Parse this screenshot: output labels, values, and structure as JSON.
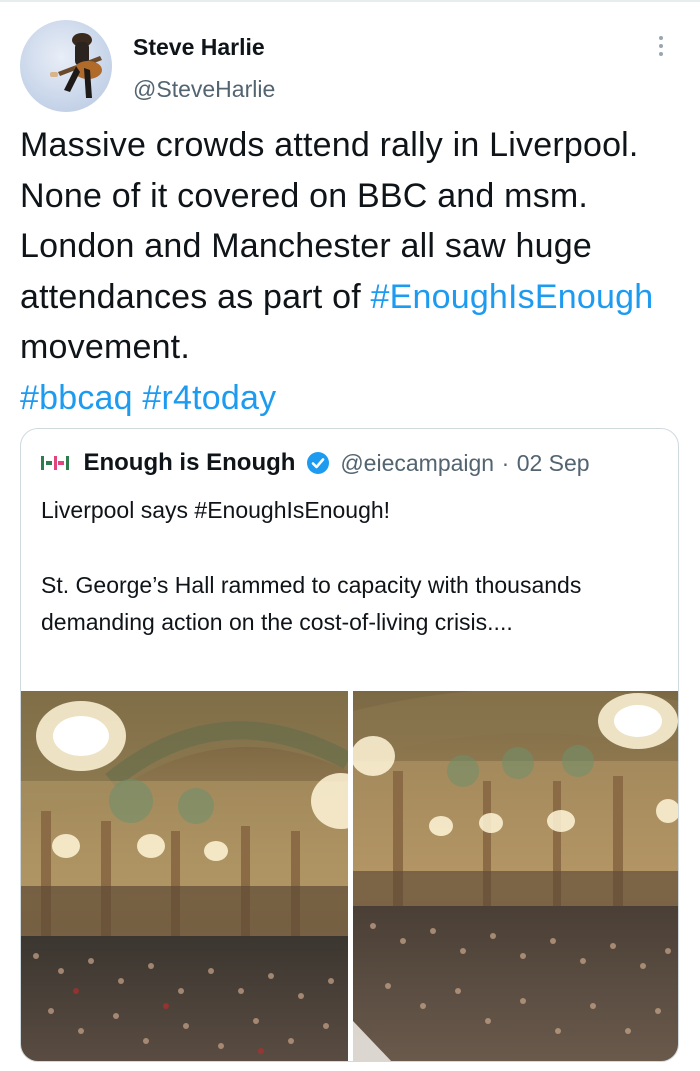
{
  "author": {
    "name": "Steve Harlie",
    "handle": "@SteveHarlie",
    "avatar_icon": "guitar-player-avatar"
  },
  "tweet": {
    "text_parts": [
      "Massive crowds attend rally in Liverpool. None of it covered on BBC and msm. London and Manchester all saw huge attendances as part of ",
      " movement. "
    ],
    "hashtags": [
      "#EnoughIsEnough",
      "#bbcaq",
      "#r4today"
    ]
  },
  "quoted": {
    "name": "Enough is Enough",
    "handle": "@eiecampaign",
    "separator": "·",
    "date": "02 Sep",
    "line1": "Liverpool says #EnoughIsEnough!",
    "line2": "St. George’s Hall rammed to capacity with thousands demanding action on the cost-of-living crisis....",
    "photos": [
      "hall-photo-1",
      "hall-photo-2"
    ]
  },
  "colors": {
    "link": "#1d9bf0",
    "secondary_text": "#536471",
    "verified": "#1d9bf0",
    "border": "#cfd9de"
  }
}
